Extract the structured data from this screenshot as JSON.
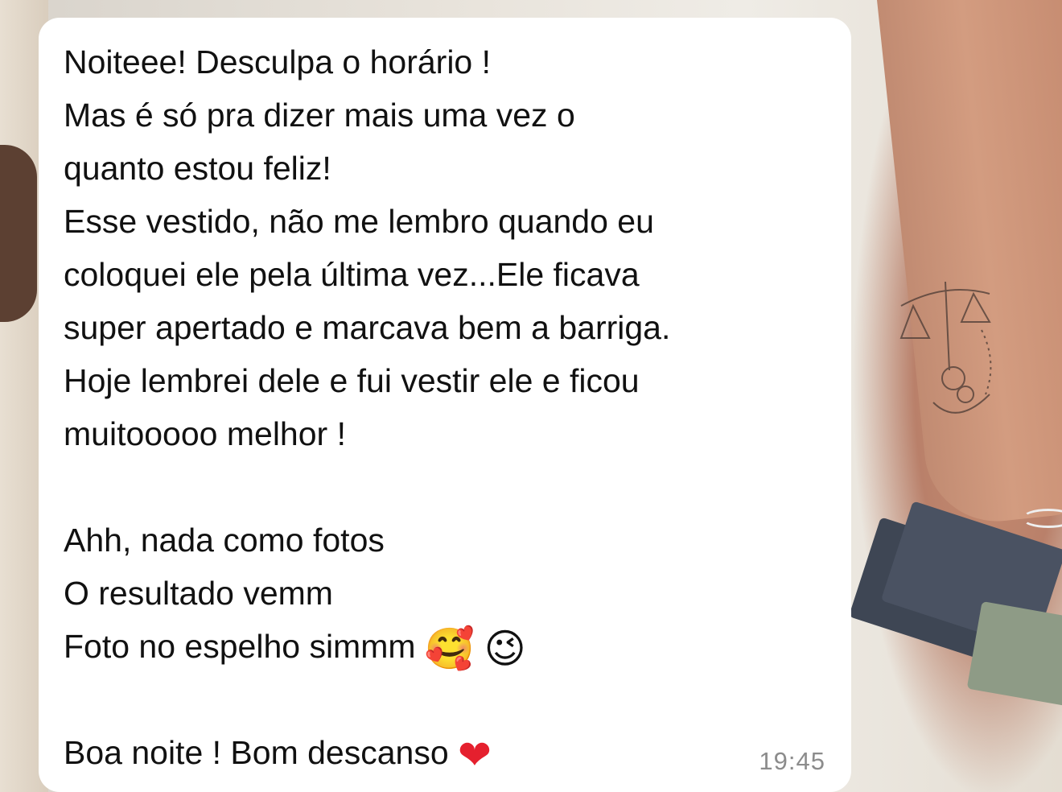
{
  "message": {
    "lines": [
      "Noiteee! Desculpa o horário !",
      "Mas é só pra dizer mais uma vez o",
      "quanto estou feliz!",
      "Esse vestido, não me lembro quando eu",
      "coloquei ele pela última vez...Ele ficava",
      "super apertado e marcava bem a barriga.",
      "Hoje lembrei dele e fui vestir ele e ficou",
      "muitooooo melhor !",
      "",
      "Ahh, nada como fotos",
      "O resultado vemm",
      "Foto no espelho simmm",
      "",
      "Boa noite ! Bom descanso"
    ],
    "emoji_line_11": [
      "smiling-face-with-hearts",
      "winking-face"
    ],
    "emoji_line_13": [
      "red-heart"
    ],
    "timestamp": "19:45"
  },
  "colors": {
    "bubble": "#ffffff",
    "text": "#111111",
    "timestamp": "#8c8c8c",
    "heart": "#e5202e"
  }
}
